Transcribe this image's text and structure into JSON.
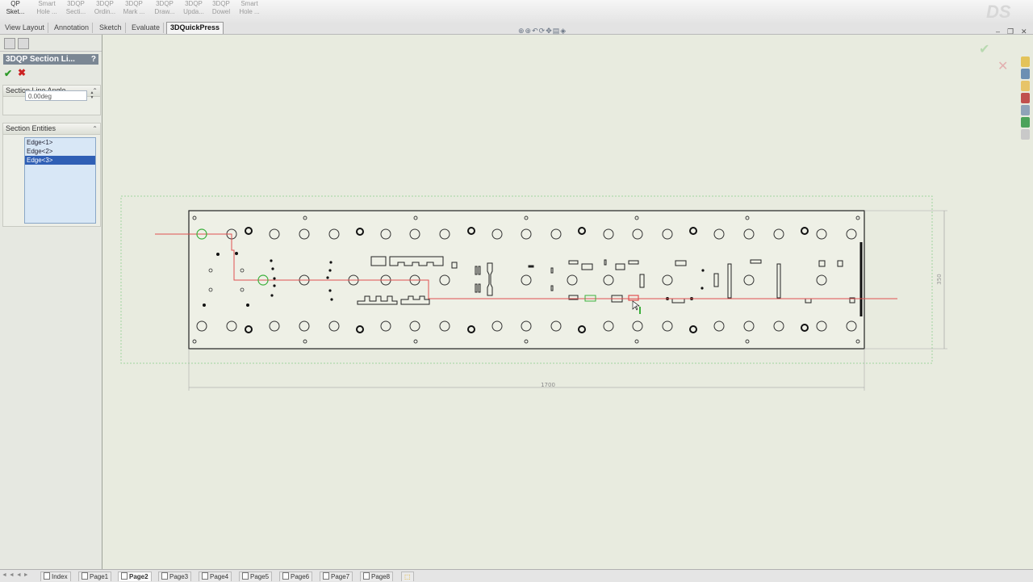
{
  "toolbar": {
    "sketch": {
      "line1": "QP",
      "line2": "Sket..."
    },
    "buttons": [
      {
        "l1": "Smart",
        "l2": "Hole ..."
      },
      {
        "l1": "3DQP",
        "l2": "Secti..."
      },
      {
        "l1": "3DQP",
        "l2": "Ordin..."
      },
      {
        "l1": "3DQP",
        "l2": "Mark ..."
      },
      {
        "l1": "3DQP",
        "l2": "Draw..."
      },
      {
        "l1": "3DQP",
        "l2": "Upda..."
      },
      {
        "l1": "3DQP",
        "l2": "Dowel"
      },
      {
        "l1": "Smart",
        "l2": "Hole ..."
      }
    ],
    "logo": "DS"
  },
  "tabs": [
    "View Layout",
    "Annotation",
    "Sketch",
    "Evaluate",
    "3DQuickPress"
  ],
  "active_tab": "3DQuickPress",
  "panel": {
    "title": "3DQP Section Li...",
    "help": "?",
    "ok_icon": "checkmark-icon",
    "cancel_icon": "x-icon",
    "angle_group": {
      "title": "Section Line Angle",
      "value": "0.00deg"
    },
    "entities_group": {
      "title": "Section Entities",
      "items": [
        "Edge<1>",
        "Edge<2>",
        "Edge<3>"
      ],
      "selected": 2
    }
  },
  "drawing": {
    "dim_width": "1700",
    "dim_height": "350"
  },
  "status_tabs": [
    "Index",
    "Page1",
    "Page2",
    "Page3",
    "Page4",
    "Page5",
    "Page6",
    "Page7",
    "Page8"
  ],
  "active_status_tab": "Page2",
  "colors": {
    "section_line": "#e05050",
    "selected_hole": "#3cb03c",
    "panel_header": "#7b8794",
    "canvas_bg": "#e8ebdf"
  }
}
